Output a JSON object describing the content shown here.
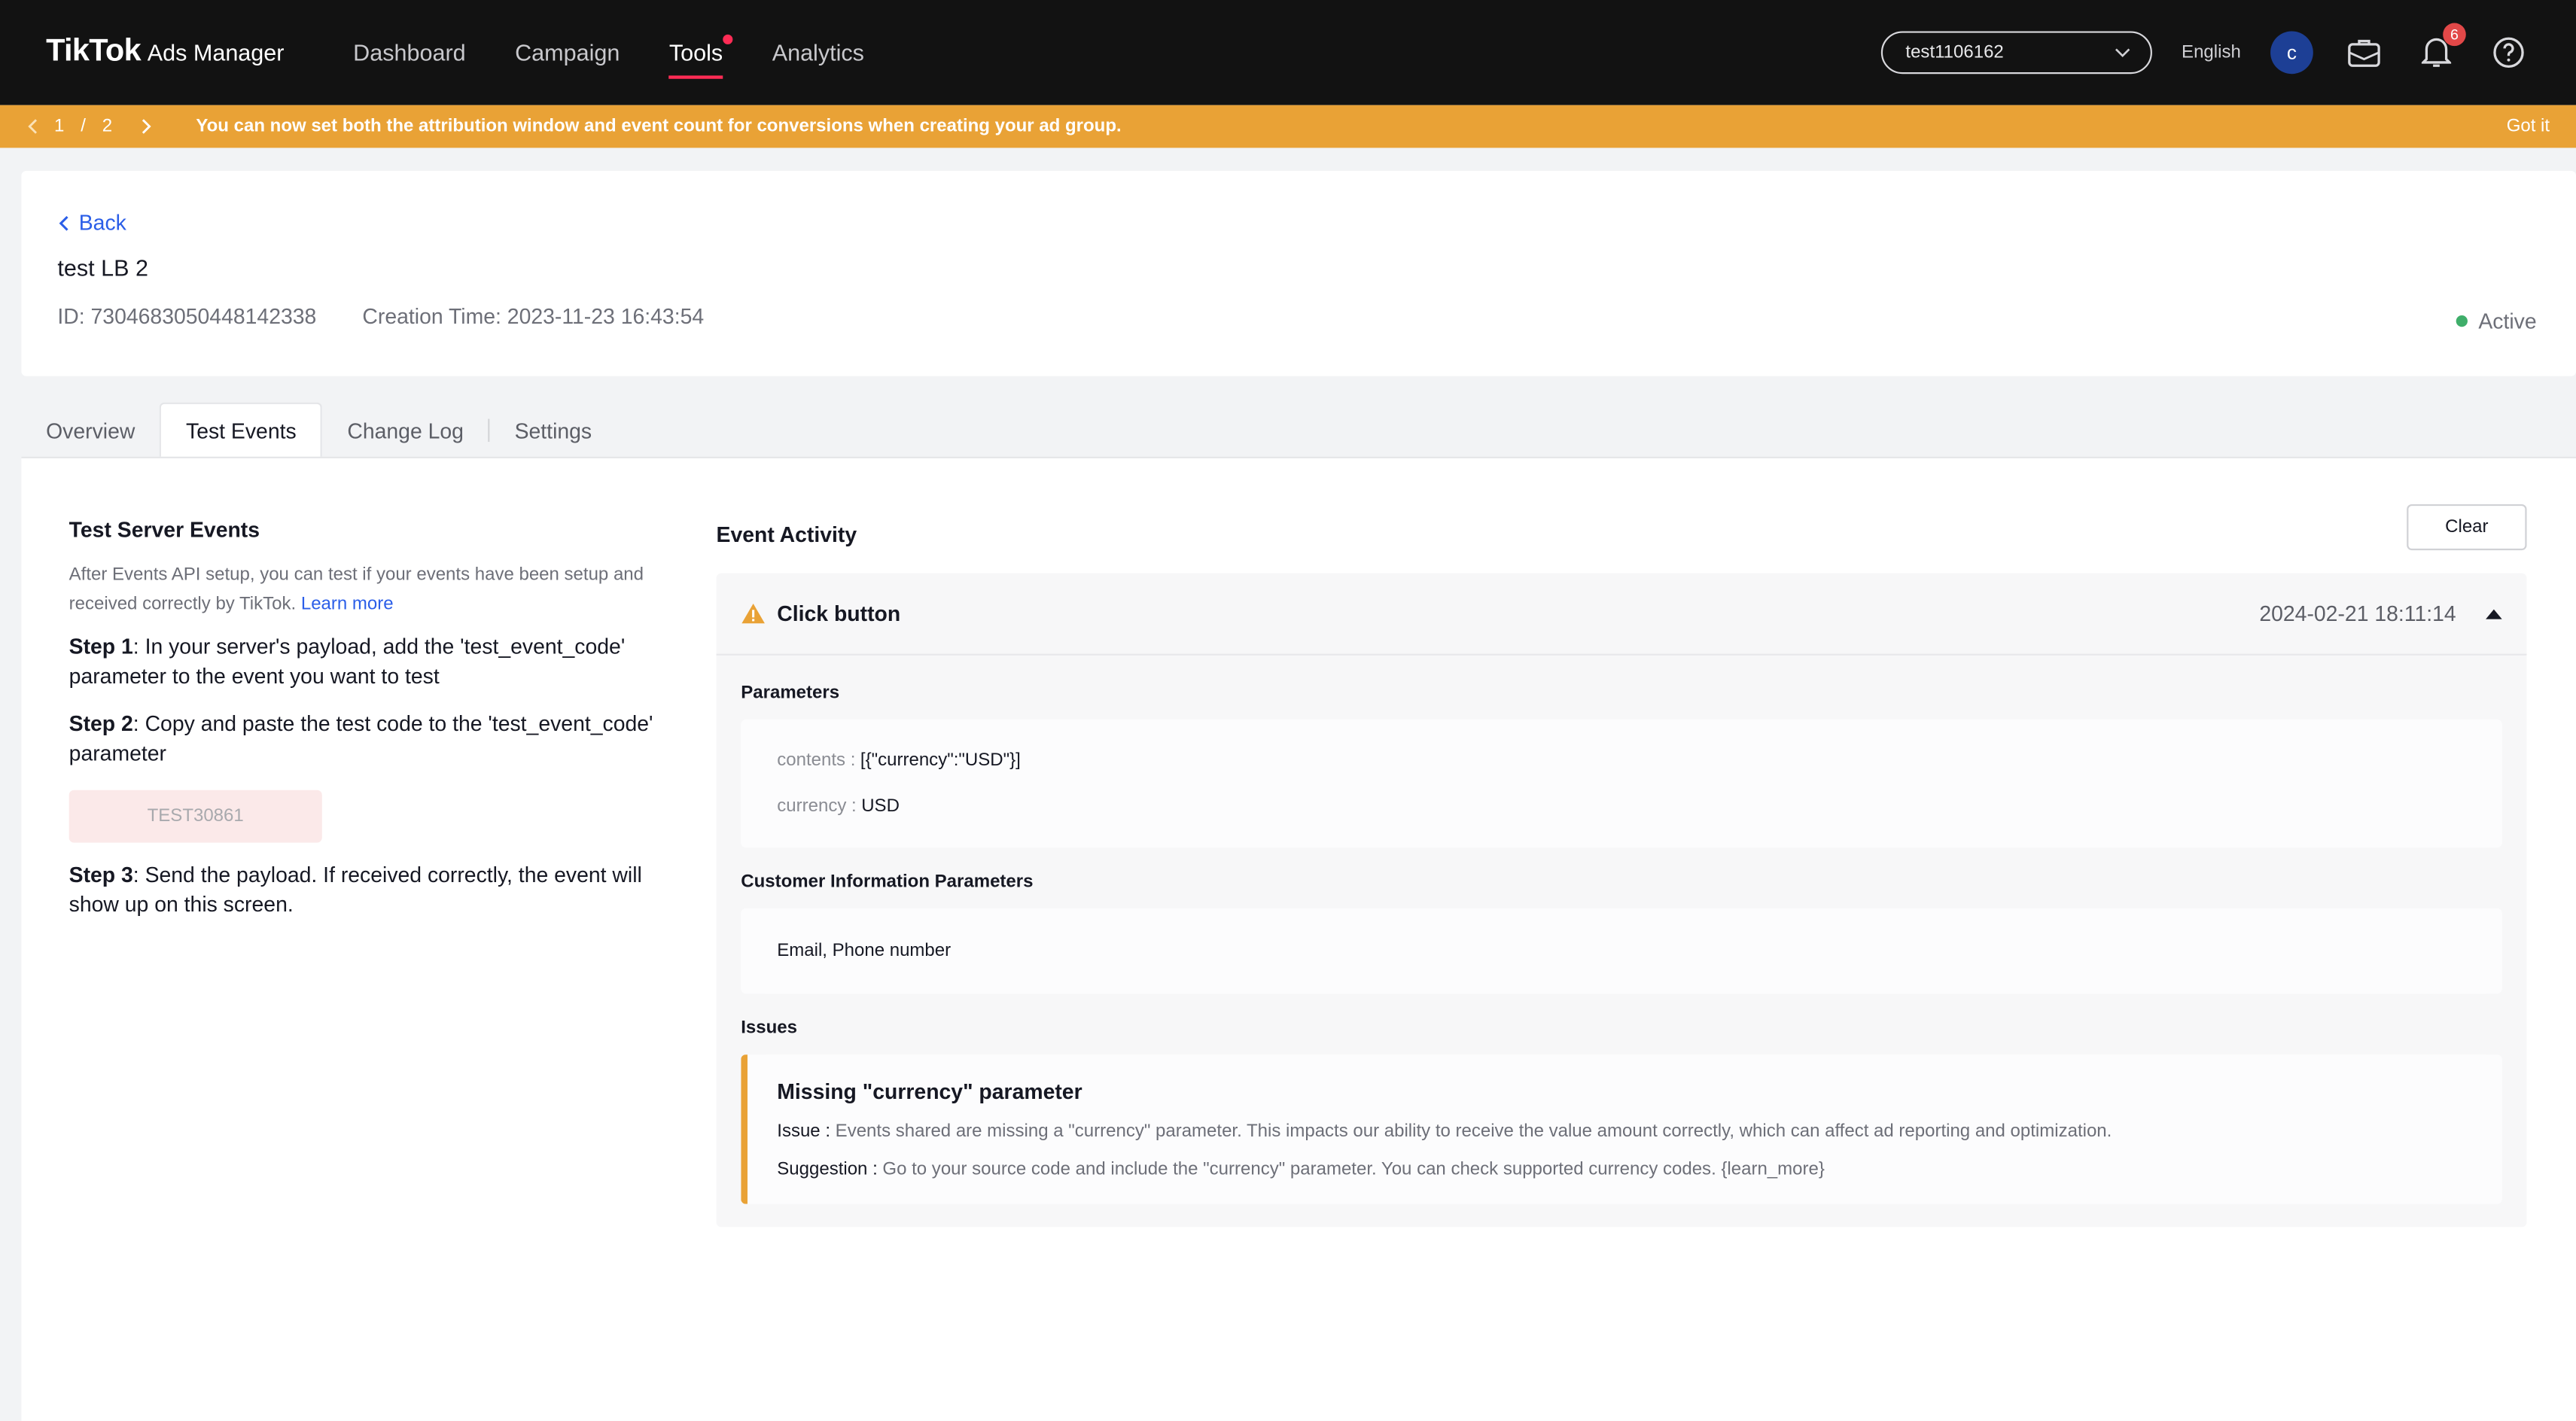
{
  "topnav": {
    "brand": "TikTok",
    "brand_sub": "Ads Manager",
    "items": [
      {
        "label": "Dashboard"
      },
      {
        "label": "Campaign"
      },
      {
        "label": "Tools"
      },
      {
        "label": "Analytics"
      }
    ],
    "account": "test1106162",
    "language": "English",
    "avatar_letter": "c",
    "notifications_count": "6"
  },
  "banner": {
    "page_current": "1",
    "page_sep": "/",
    "page_total": "2",
    "message": "You can now set both the attribution window and event count for conversions when creating your ad group.",
    "dismiss": "Got it"
  },
  "header": {
    "back_label": "Back",
    "title": "test LB 2",
    "id_text": "ID: 7304683050448142338",
    "creation_text": "Creation Time: 2023-11-23 16:43:54",
    "status": "Active"
  },
  "tabs": [
    {
      "label": "Overview"
    },
    {
      "label": "Test Events"
    },
    {
      "label": "Change Log"
    },
    {
      "label": "Settings"
    }
  ],
  "test_server": {
    "title": "Test Server Events",
    "desc": "After Events API setup, you can test if your events have been setup and received correctly by TikTok.",
    "learn_more": "Learn more",
    "step1_label": "Step 1",
    "step1_text": ": In your server's payload, add the 'test_event_code' parameter to the event you want to test",
    "step2_label": "Step 2",
    "step2_text": ": Copy and paste the test code to the 'test_event_code' parameter",
    "code": "TEST30861",
    "step3_label": "Step 3",
    "step3_text": ": Send the payload. If received correctly, the event will show up on this screen."
  },
  "activity": {
    "title": "Event Activity",
    "clear_label": "Clear",
    "event": {
      "name": "Click button",
      "time": "2024-02-21 18:11:14",
      "params_title": "Parameters",
      "params": [
        {
          "k": "contents :",
          "v": "[{\"currency\":\"USD\"}]"
        },
        {
          "k": "currency :",
          "v": "USD"
        }
      ],
      "customer_title": "Customer Information Parameters",
      "customer_value": "Email, Phone number",
      "issues_title": "Issues",
      "issue": {
        "title": "Missing \"currency\" parameter",
        "issue_label": "Issue :",
        "issue_text": "Events shared are missing a \"currency\" parameter. This impacts our ability to receive the value amount correctly, which can affect ad reporting and optimization.",
        "suggestion_label": "Suggestion :",
        "suggestion_text": "Go to your source code and include the \"currency\" parameter. You can check supported currency codes. {learn_more}"
      }
    }
  },
  "colors": {
    "accent": "#fe2c55",
    "banner": "#e9a236",
    "link": "#2b5ee8",
    "active_dot": "#3fae6a"
  }
}
